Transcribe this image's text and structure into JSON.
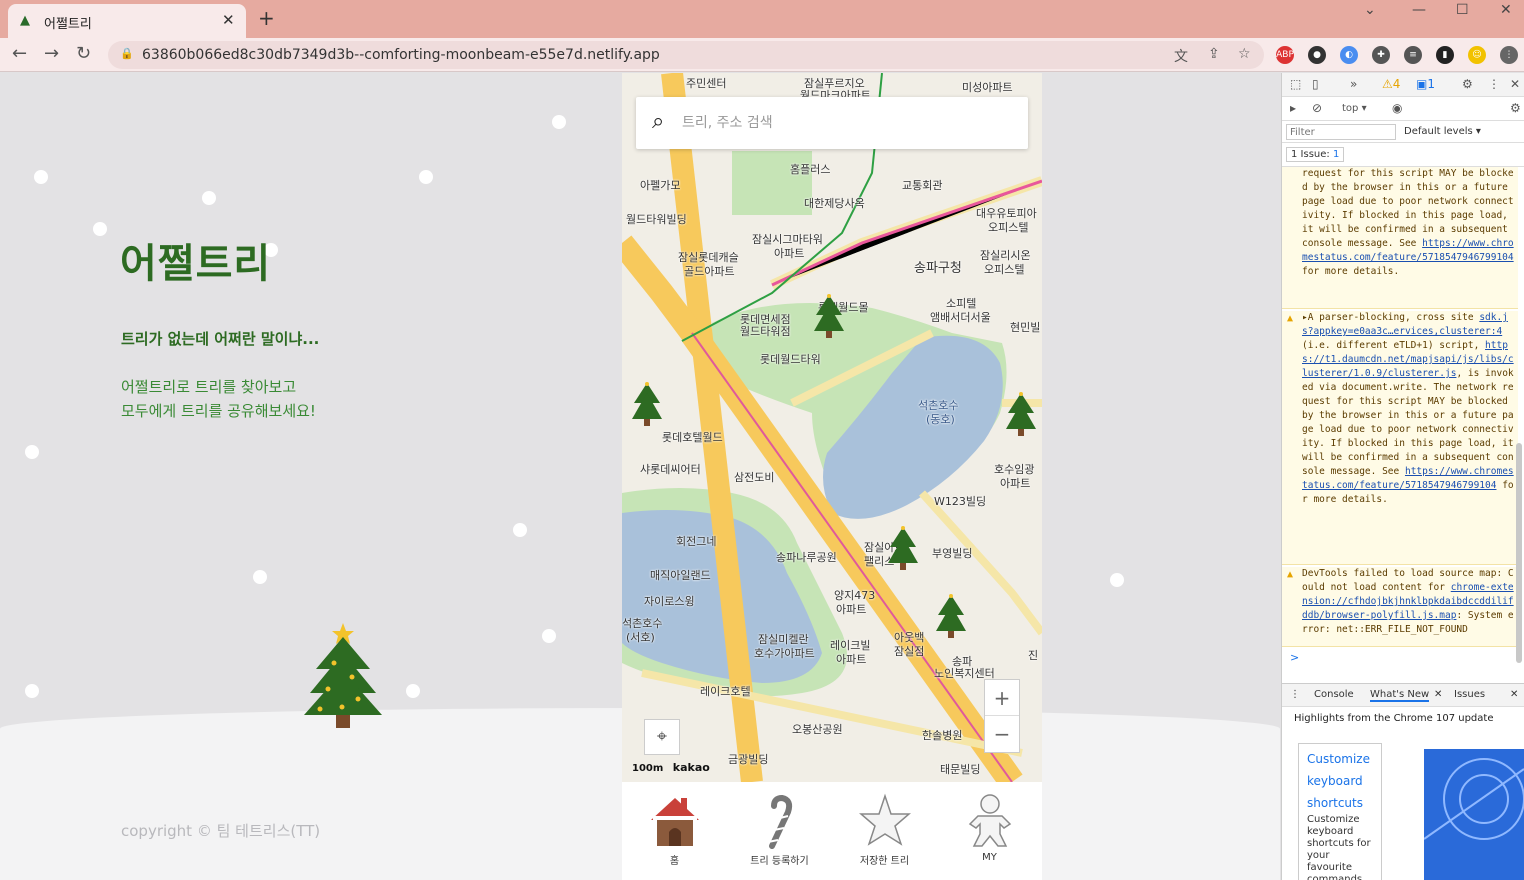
{
  "browser": {
    "tab_title": "어쩔트리",
    "url": "63860b066ed8c30db7349d3b--comforting-moonbeam-e55e7d.netlify.app",
    "window_controls": [
      "minimize-icon",
      "maximize-icon",
      "close-icon"
    ]
  },
  "hero": {
    "logo": "어쩔트리",
    "tagline": "트리가 없는데 어쩌란 말이냐...",
    "desc_line1": "어쩔트리로 트리를 찾아보고",
    "desc_line2": "모두에게 트리를 공유해보세요!",
    "copyright": "copyright © 팀 테트리스(TT)"
  },
  "map": {
    "search_placeholder": "트리, 주소 검색",
    "labels": [
      "주민센터",
      "잠실푸르지오",
      "월드마크아파트",
      "미성아파트",
      "홈플러스",
      "아펠가모",
      "교통회관",
      "대한제당사옥",
      "월드타워빌딩",
      "대우유토피아",
      "오피스텔",
      "잠실시그마타워",
      "아파트",
      "잠실롯데캐슬",
      "골드아파트",
      "송파구청",
      "잠실리시온",
      "오피스텔",
      "롯데월드몰",
      "롯데면세점",
      "월드타워점",
      "소피텔",
      "앰배서더서울",
      "현민빌",
      "롯데월드타워",
      "석촌호수",
      "(동호)",
      "롯데호텔월드",
      "샤롯데씨어터",
      "삼전도비",
      "호수임광",
      "아파트",
      "W123빌딩",
      "회전그네",
      "송파나루공원",
      "잠실아보",
      "팰리스",
      "부영빌딩",
      "매직아일랜드",
      "자이로스윙",
      "양지473",
      "아파트",
      "석촌호수",
      "(서호)",
      "잠실미켈란",
      "호수가아파트",
      "레이크빌",
      "아파트",
      "아웃백",
      "잠실점",
      "송파",
      "노인복지센터",
      "레이크호텔",
      "오봉산공원",
      "한솔병원",
      "금광빌딩",
      "태문빌딩",
      "진"
    ],
    "scale": "100m",
    "brand": "kakao",
    "zoom_in": "+",
    "zoom_out": "−"
  },
  "bottom_nav": [
    {
      "label": "홈"
    },
    {
      "label": "트리 등록하기"
    },
    {
      "label": "저장한 트리"
    },
    {
      "label": "MY"
    }
  ],
  "devtools": {
    "context": "top",
    "filter_placeholder": "Filter",
    "levels": "Default levels",
    "issues_label": "1 Issue:",
    "issues_count": "1",
    "warn_count": "4",
    "msg_count": "1",
    "warn1_text": "request for this script MAY be blocked by the browser in this or a future page load due to poor network connectivity. If blocked in this page load, it will be confirmed in a subsequent console message. See",
    "warn1_link": "https://www.chromestatus.com/feature/5718547946799104",
    "warn1_tail": "for more details.",
    "warn2_head": "▸A parser-blocking, cross site",
    "warn2_src": "sdk.js?appkey=e0aa3c…ervices,clusterer:4",
    "warn2_body1": "(i.e. different eTLD+1) script,",
    "warn2_link1": "https://t1.daumcdn.net/mapjsapi/js/libs/clusterer/1.0.9/clusterer.js",
    "warn2_body2": ", is invoked via document.write. The network request for this script MAY be blocked by the browser in this or a future page load due to poor network connectivity. If blocked in this page load, it will be confirmed in a subsequent console message. See",
    "warn2_link2": "https://www.chromestatus.com/feature/5718547946799104",
    "warn2_tail": "for more details.",
    "warn3_body": "DevTools failed to load source map: Could not load content for",
    "warn3_link": "chrome-extension://cfhdojbkjhnklbpkdaibdccddilifddb/browser-polyfill.js.map",
    "warn3_tail": ": System error: net::ERR_FILE_NOT_FOUND",
    "prompt": ">",
    "drawer_tabs": [
      "Console",
      "What's New",
      "Issues"
    ],
    "whatsnew_heading": "Highlights from the Chrome 107 update",
    "card_link1": "Customize",
    "card_link2": "keyboard",
    "card_link3": "shortcuts",
    "card_desc": "Customize keyboard shortcuts for your favourite commands"
  },
  "colors": {
    "brand_green": "#2d6b22",
    "tab_bar": "#e6aaa0"
  }
}
